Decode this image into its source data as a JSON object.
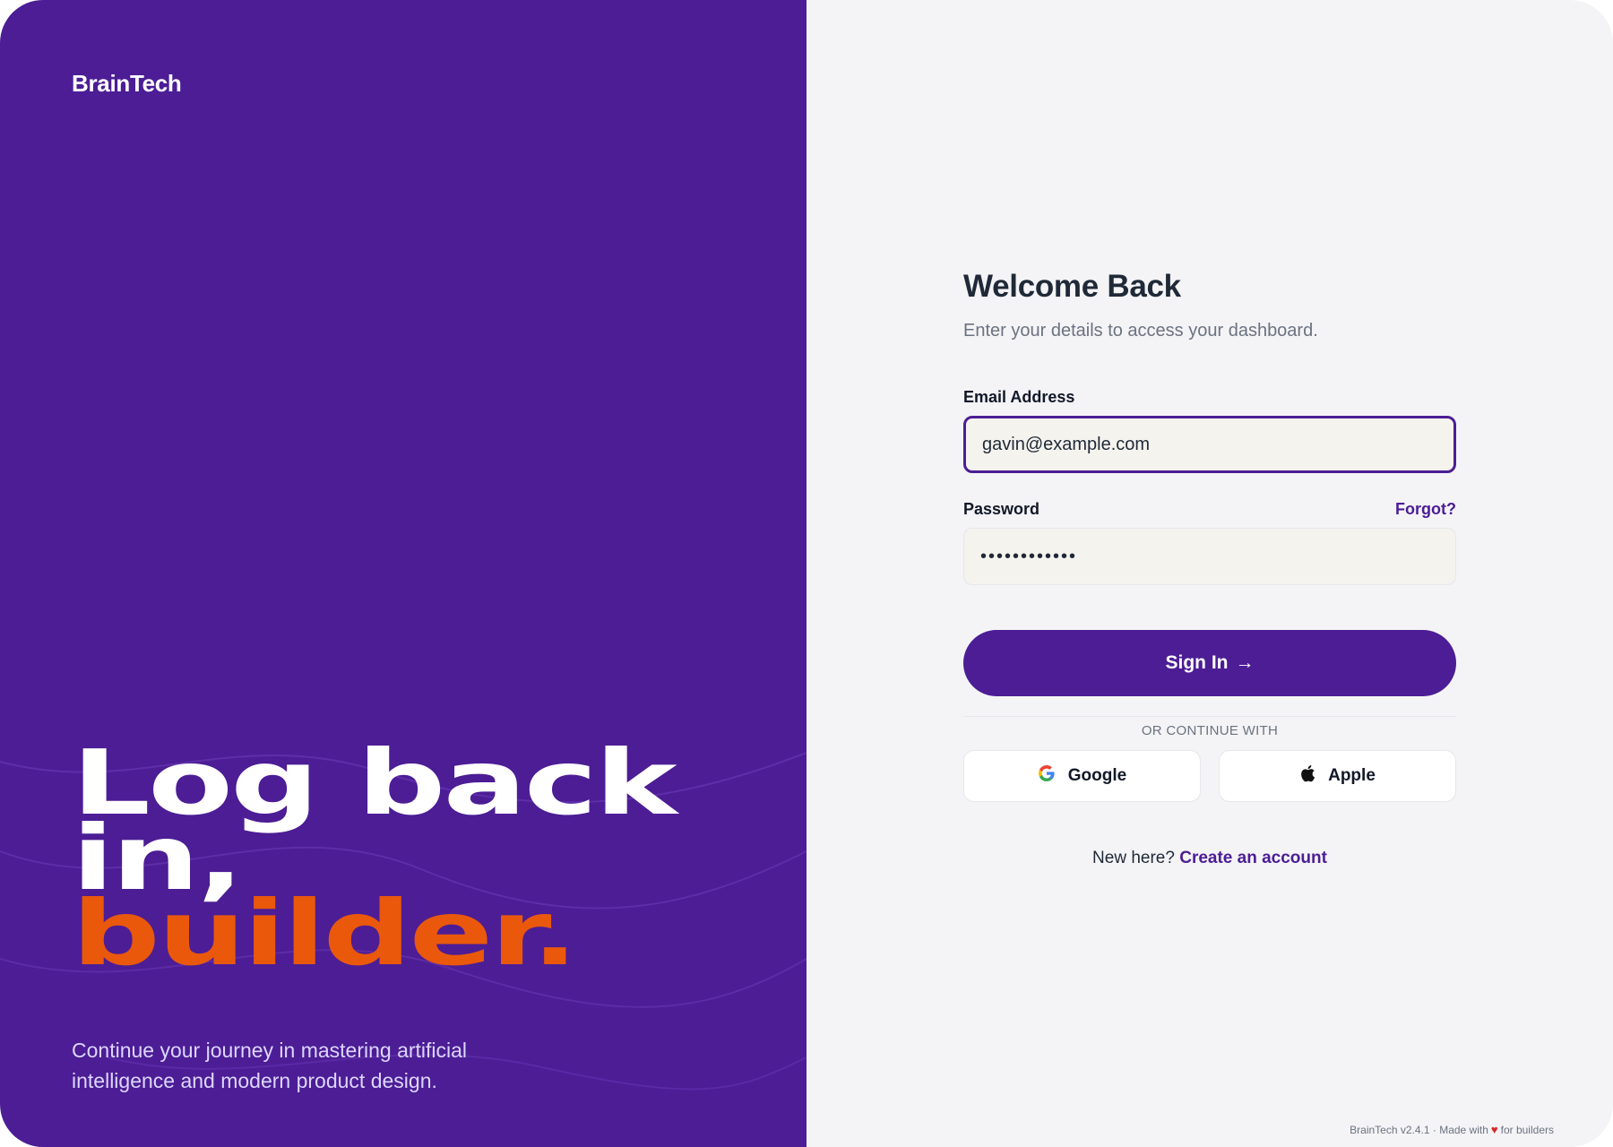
{
  "brand": "BrainTech",
  "hero": {
    "line1": "Log back",
    "line2": "in,",
    "line3": "builder.",
    "tagline": "Continue your journey in mastering artificial intelligence and modern product design."
  },
  "login": {
    "title": "Welcome Back",
    "subtitle": "Enter your details to access your dashboard.",
    "email_label": "Email Address",
    "email_value": "gavin@example.com",
    "password_label": "Password",
    "password_value": "••••••••••••",
    "forgot_label": "Forgot?",
    "signin_label": "Sign In",
    "signin_arrow": "→",
    "divider_label": "OR CONTINUE WITH",
    "google_label": "Google",
    "apple_label": "Apple",
    "signup_prompt": "New here?",
    "signup_link": "Create an account"
  },
  "footer": {
    "left": "BrainTech v2.4.1 · Made with",
    "heart": "♥",
    "right": "for builders"
  },
  "colors": {
    "primary": "#4c1d95",
    "accent": "#ea580c",
    "panel_bg": "#f4f4f6",
    "input_bg": "#f5f3ee"
  },
  "icons": {
    "google": "google-icon",
    "apple": "apple-icon",
    "arrow": "arrow-right-icon",
    "heart": "heart-icon"
  }
}
